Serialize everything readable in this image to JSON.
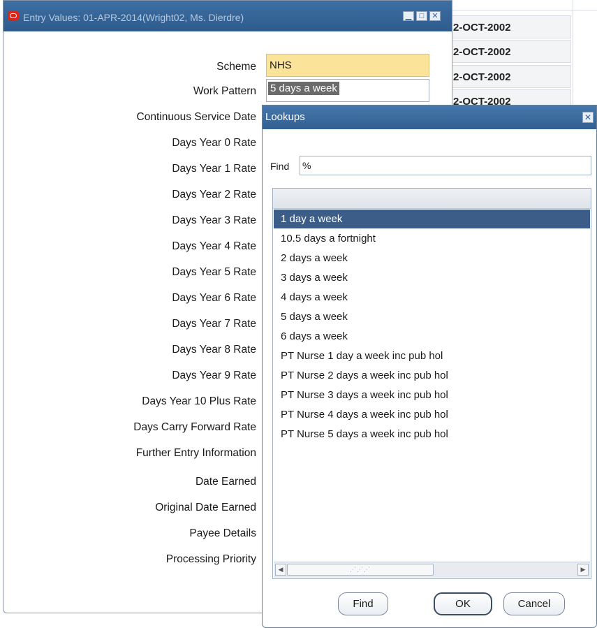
{
  "background_table": {
    "rows": [
      "2-OCT-2002",
      "2-OCT-2002",
      "2-OCT-2002",
      "2-OCT-2002"
    ]
  },
  "entry_window": {
    "title": "Entry Values: 01-APR-2014(Wright02, Ms. Dierdre)",
    "labels": [
      "Scheme",
      "Work Pattern",
      "Continuous Service Date",
      "Days Year 0 Rate",
      "Days Year 1 Rate",
      "Days Year 2 Rate",
      "Days Year 3 Rate",
      "Days Year 4 Rate",
      "Days Year 5 Rate",
      "Days Year 6 Rate",
      "Days Year 7 Rate",
      "Days Year 8 Rate",
      "Days Year 9 Rate",
      "Days Year 10 Plus Rate",
      "Days Carry Forward Rate",
      "Further Entry Information",
      "Date Earned",
      "Original Date Earned",
      "Payee Details",
      "Processing Priority"
    ],
    "scheme_value": "NHS",
    "work_pattern_value": "5 days a week"
  },
  "lookups_dialog": {
    "title": "Lookups",
    "find_label": "Find",
    "find_value": "%",
    "items": [
      "1 day a week",
      "10.5 days a fortnight",
      "2 days a week",
      "3 days a week",
      "4 days a week",
      "5 days a week",
      "6 days a week",
      "PT Nurse 1 day a week inc pub hol",
      "PT Nurse 2 days a week inc pub hol",
      "PT Nurse 3 days a week inc pub hol",
      "PT Nurse 4 days a week inc pub hol",
      "PT Nurse 5 days a week inc pub hol"
    ],
    "selected_index": 0,
    "buttons": {
      "find": "Find",
      "ok": "OK",
      "cancel": "Cancel"
    }
  },
  "colors": {
    "titlebar": "#2e5b8c",
    "selected_row": "#3c5d88",
    "required_field": "#fbe39a"
  }
}
